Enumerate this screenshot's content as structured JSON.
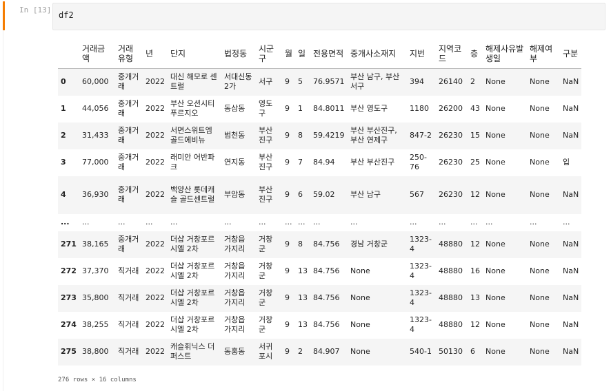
{
  "cell": {
    "prompt": "In [13]:",
    "code": "df2"
  },
  "table": {
    "columns": [
      "거래금액",
      "거래유형",
      "년",
      "단지",
      "법정동",
      "시군구",
      "월",
      "일",
      "전용면적",
      "중개사소재지",
      "지번",
      "지역코드",
      "층",
      "해제사유발생일",
      "해제여부",
      "구분"
    ],
    "rows": [
      {
        "index": "0",
        "cells": [
          "60,000",
          "중개거래",
          "2022",
          "대신 해모로 센트럴",
          "서대신동2가",
          "서구",
          "9",
          "5",
          "76.9571",
          "부산 남구, 부산 서구",
          "394",
          "26140",
          "2",
          "None",
          "None",
          "NaN"
        ]
      },
      {
        "index": "1",
        "cells": [
          "44,056",
          "중개거래",
          "2022",
          "부산 오션시티 푸르지오",
          "동삼동",
          "영도구",
          "9",
          "1",
          "84.8011",
          "부산 영도구",
          "1180",
          "26200",
          "43",
          "None",
          "None",
          "NaN"
        ]
      },
      {
        "index": "2",
        "cells": [
          "31,433",
          "중개거래",
          "2022",
          "서면스위트엠골드에비뉴",
          "범천동",
          "부산진구",
          "9",
          "8",
          "59.4219",
          "부산 부산진구, 부산 연제구",
          "847-2",
          "26230",
          "15",
          "None",
          "None",
          "NaN"
        ]
      },
      {
        "index": "3",
        "cells": [
          "77,000",
          "중개거래",
          "2022",
          "래미안 어반파크",
          "연지동",
          "부산진구",
          "9",
          "7",
          "84.94",
          "부산 부산진구",
          "250-76",
          "26230",
          "25",
          "None",
          "None",
          "입"
        ]
      },
      {
        "index": "4",
        "cells": [
          "36,930",
          "중개거래",
          "2022",
          "백양산 롯데캐슬 골드센트럴",
          "부암동",
          "부산진구",
          "9",
          "6",
          "59.02",
          "부산 남구",
          "567",
          "26230",
          "12",
          "None",
          "None",
          "NaN"
        ]
      },
      {
        "index": "...",
        "cells": [
          "...",
          "...",
          "...",
          "...",
          "...",
          "...",
          "...",
          "...",
          "...",
          "...",
          "...",
          "...",
          "...",
          "...",
          "...",
          "..."
        ]
      },
      {
        "index": "271",
        "cells": [
          "38,165",
          "중개거래",
          "2022",
          "더샵 거창포르시엘 2차",
          "거창읍 가지리",
          "거창군",
          "9",
          "8",
          "84.756",
          "경남 거창군",
          "1323-4",
          "48880",
          "12",
          "None",
          "None",
          "NaN"
        ]
      },
      {
        "index": "272",
        "cells": [
          "37,370",
          "직거래",
          "2022",
          "더샵 거창포르시엘 2차",
          "거창읍 가지리",
          "거창군",
          "9",
          "13",
          "84.756",
          "None",
          "1323-4",
          "48880",
          "16",
          "None",
          "None",
          "NaN"
        ]
      },
      {
        "index": "273",
        "cells": [
          "35,800",
          "직거래",
          "2022",
          "더샵 거창포르시엘 2차",
          "거창읍 가지리",
          "거창군",
          "9",
          "13",
          "84.756",
          "None",
          "1323-4",
          "48880",
          "13",
          "None",
          "None",
          "NaN"
        ]
      },
      {
        "index": "274",
        "cells": [
          "38,255",
          "직거래",
          "2022",
          "더샵 거창포르시엘 2차",
          "거창읍 가지리",
          "거창군",
          "9",
          "13",
          "84.756",
          "None",
          "1323-4",
          "48880",
          "12",
          "None",
          "None",
          "NaN"
        ]
      },
      {
        "index": "275",
        "cells": [
          "38,800",
          "직거래",
          "2022",
          "캐슬휘닉스 더 퍼스트",
          "동홍동",
          "서귀포시",
          "9",
          "2",
          "84.907",
          "None",
          "540-1",
          "50130",
          "6",
          "None",
          "None",
          "NaN"
        ]
      }
    ],
    "footer": "276 rows × 16 columns"
  }
}
